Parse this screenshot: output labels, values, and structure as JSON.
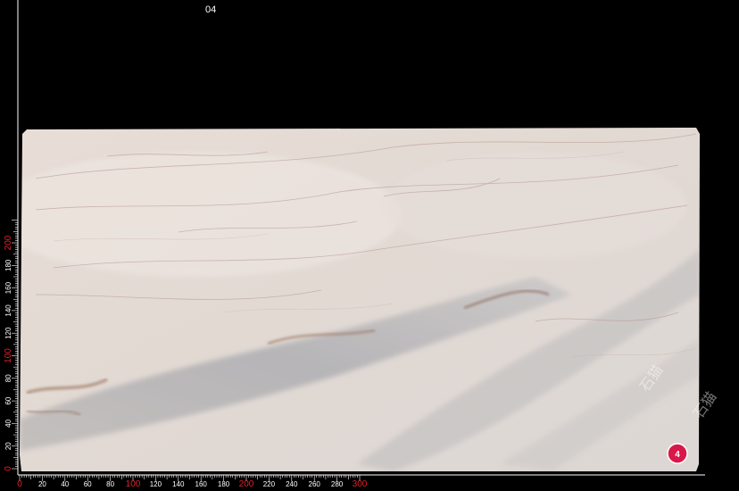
{
  "image": {
    "slab_number": "04",
    "badge_number": "4",
    "watermark_text": "石猫",
    "background_color": "#000000",
    "ruler_color": "#ffffff",
    "ruler_highlight_color": "#e0202a",
    "badge_color": "#d9184a"
  },
  "ruler_x": {
    "labels": [
      "0",
      "20",
      "40",
      "60",
      "80",
      "100",
      "120",
      "140",
      "160",
      "180",
      "200",
      "220",
      "240",
      "260",
      "280",
      "300"
    ],
    "highlighted": [
      "0",
      "100",
      "200",
      "300"
    ]
  },
  "ruler_y": {
    "labels": [
      "0",
      "20",
      "40",
      "60",
      "80",
      "100",
      "120",
      "140",
      "160",
      "180",
      "200"
    ],
    "highlighted": [
      "0",
      "100",
      "200"
    ]
  }
}
